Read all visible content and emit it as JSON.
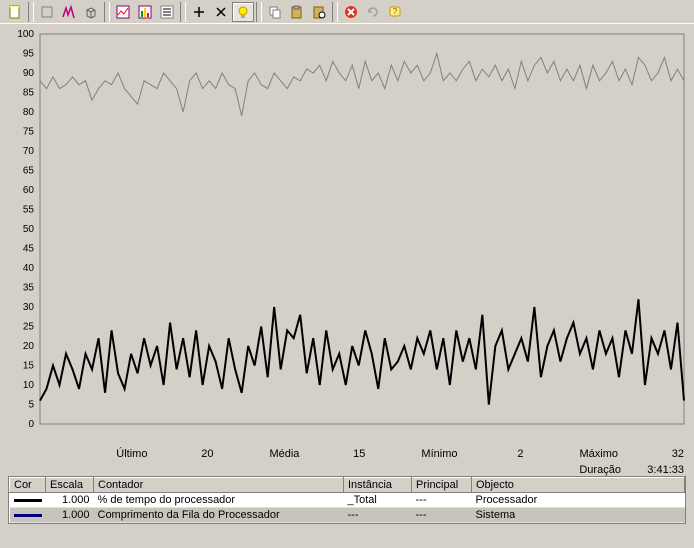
{
  "toolbar": {
    "icons": [
      "new",
      "open",
      "spike",
      "cube",
      "chart1",
      "chart2",
      "list",
      "plus",
      "times",
      "bulb",
      "copy",
      "paste",
      "props",
      "stop",
      "refresh",
      "help"
    ]
  },
  "chart_data": {
    "type": "line",
    "ylim": [
      0,
      100
    ],
    "yticks": [
      0,
      5,
      10,
      15,
      20,
      25,
      30,
      35,
      40,
      45,
      50,
      55,
      60,
      65,
      70,
      75,
      80,
      85,
      90,
      95,
      100
    ],
    "series": [
      {
        "name": "% de tempo do processador",
        "color": "#808080",
        "width": 1,
        "values": [
          88,
          86,
          89,
          86,
          87,
          89,
          87,
          88,
          83,
          86,
          88,
          87,
          90,
          86,
          84,
          82,
          88,
          87,
          86,
          90,
          88,
          86,
          80,
          88,
          90,
          86,
          88,
          86,
          90,
          87,
          86,
          79,
          88,
          90,
          87,
          86,
          90,
          88,
          86,
          89,
          88,
          91,
          90,
          92,
          88,
          93,
          90,
          88,
          92,
          86,
          93,
          88,
          90,
          86,
          92,
          88,
          93,
          90,
          92,
          88,
          90,
          95,
          88,
          90,
          88,
          91,
          93,
          88,
          91,
          89,
          92,
          88,
          91,
          86,
          93,
          88,
          92,
          94,
          90,
          93,
          88,
          91,
          88,
          92,
          86,
          92,
          88,
          90,
          93,
          88,
          91,
          87,
          94,
          92,
          88,
          90,
          94,
          88,
          91,
          88
        ]
      },
      {
        "name": "Comprimento da Fila do Processador",
        "color": "#000000",
        "width": 2,
        "values": [
          6,
          9,
          15,
          10,
          18,
          14,
          9,
          18,
          14,
          22,
          8,
          24,
          13,
          9,
          18,
          13,
          22,
          15,
          20,
          10,
          26,
          14,
          22,
          12,
          24,
          10,
          20,
          16,
          9,
          22,
          14,
          8,
          20,
          15,
          25,
          12,
          30,
          14,
          24,
          22,
          28,
          13,
          22,
          10,
          24,
          14,
          18,
          10,
          20,
          15,
          24,
          18,
          9,
          22,
          14,
          16,
          20,
          14,
          22,
          18,
          24,
          14,
          22,
          10,
          24,
          16,
          22,
          14,
          28,
          5,
          20,
          24,
          14,
          18,
          22,
          16,
          30,
          12,
          20,
          24,
          16,
          22,
          26,
          18,
          22,
          14,
          24,
          18,
          22,
          12,
          24,
          18,
          32,
          10,
          22,
          18,
          24,
          14,
          26,
          6
        ]
      }
    ]
  },
  "stats": {
    "ultimo_label": "Último",
    "ultimo_val": "20",
    "media_label": "Média",
    "media_val": "15",
    "minimo_label": "Mínimo",
    "minimo_val": "2",
    "maximo_label": "Máximo",
    "maximo_val": "32",
    "duracao_label": "Duração",
    "duracao_val": "3:41:33"
  },
  "table": {
    "headers": {
      "cor": "Cor",
      "escala": "Escala",
      "contador": "Contador",
      "instancia": "Instância",
      "principal": "Principal",
      "objecto": "Objecto"
    },
    "rows": [
      {
        "color": "#000000",
        "escala": "1.000",
        "contador": "% de tempo do processador",
        "instancia": "_Total",
        "principal": "---",
        "objecto": "Processador"
      },
      {
        "color": "#000080",
        "escala": "1.000",
        "contador": "Comprimento da Fila do Processador",
        "instancia": "---",
        "principal": "---",
        "objecto": "Sistema"
      }
    ]
  }
}
